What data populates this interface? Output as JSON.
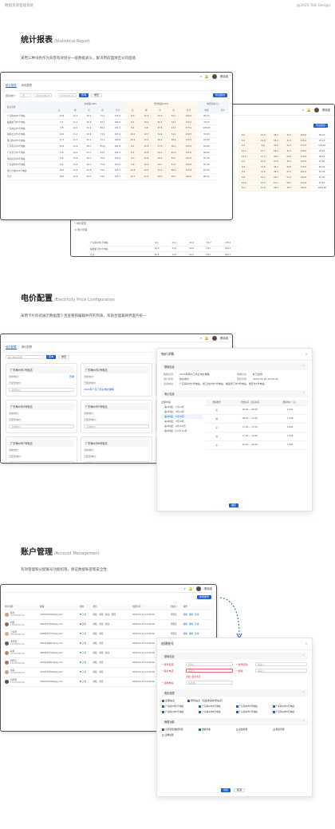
{
  "header": {
    "left": "数据资源管理系统",
    "right": "@2025 ToB Design"
  },
  "sections": [
    {
      "title": "统计报表",
      "en": "/Statistical Report",
      "desc": "采用三种浅色作为背景有效划分一级数据表头，解决用前面清区分的困境"
    },
    {
      "title": "电价配置",
      "en": "/Electricity Price Configuration",
      "desc": "采用卡片形式展示数据量少且查看和编辑并存的列表，有助合理兼顾界面齐统一"
    },
    {
      "title": "账户管理",
      "en": "/Account Management",
      "desc": "有效管理和分配账号功能权限，保证数据私密和安全性"
    }
  ],
  "user": {
    "name": "曹晓强"
  },
  "report": {
    "tabs": [
      "统计报表",
      "用电报表"
    ],
    "filter_label": "报表统计：",
    "filter_value": "日",
    "date_start": "2024-08-15",
    "date_end": "2024-08-15",
    "query": "查询",
    "reset": "重置",
    "export": "导出报表",
    "groups": [
      "用电量(kWh)",
      "费用电量(kWh)",
      "电费金额(元)"
    ],
    "cols": [
      "尖",
      "峰",
      "平",
      "谷",
      "合计",
      "尖",
      "峰",
      "平",
      "谷",
      "合计",
      "电费",
      "合计"
    ],
    "first_col": "站点名称",
    "rows": [
      [
        "广东梅州市1号电站",
        "10.8",
        "12.2",
        "39.4",
        "79.2",
        "235.8",
        "8.0",
        "15.9",
        "46.3",
        "32.1",
        "100.0",
        "86.23"
      ],
      [
        "福建厦门市2号电站",
        "9.2",
        "11.2",
        "45.9",
        "84.1",
        "286.8",
        "8.2",
        "15.9",
        "52.2",
        "32.1",
        "135.0",
        "70.23"
      ],
      [
        "广东佛山市3号电站",
        "9.8",
        "16.2",
        "51.2",
        "80.0",
        "231.4",
        "8.2",
        "9.8",
        "47.6",
        "41.2",
        "173.2",
        "103.63"
      ],
      [
        "湖南长沙市4号电站",
        "10.6",
        "11.1",
        "52.8",
        "73.2",
        "265.0",
        "10.2",
        "13.7",
        "54.4",
        "31.2",
        "130.5",
        "97.03"
      ],
      [
        "浙江杭州市5号电站",
        "11.2",
        "13.3",
        "52.1",
        "75.2",
        "289.8",
        "10.9",
        "12.6",
        "46.2",
        "56.4",
        "116.9",
        "82.69"
      ],
      [
        "江苏南京市6号电站",
        "10.9",
        "12.6",
        "48.1",
        "85.0",
        "287.6",
        "9.2",
        "15.9",
        "47.8",
        "36.1",
        "125.0",
        "81.69"
      ],
      [
        "广东湛江市7号电站",
        "8.8",
        "14.2",
        "47.3",
        "83.2",
        "221.4",
        "8.2",
        "12.8",
        "46.1",
        "40.6",
        "115.0",
        "82.92"
      ],
      [
        "湖北武汉市8号电站",
        "8.8",
        "12.9",
        "45.1",
        "76.5",
        "276.4",
        "8.0",
        "11.8",
        "46.2",
        "53.7",
        "162.0",
        "87.49"
      ],
      [
        "广东深圳市9号电站",
        "9.4",
        "14.3",
        "49.1",
        "75.6",
        "253.8",
        "9.8",
        "12.2",
        "49.7",
        "51.3",
        "100.6",
        "87.49"
      ],
      [
        "浙江宁波市10号电站",
        "10.6",
        "12.8",
        "50.8",
        "79.1",
        "243.7",
        "10.6",
        "12.5",
        "51.2",
        "58.2",
        "115.8",
        "87.63"
      ],
      [
        "合计",
        "10.6",
        "13.9",
        "50.5",
        "79.1",
        "243.7",
        "10.7",
        "11.8",
        "48.3",
        "38.7",
        "160.0",
        "86.22"
      ]
    ]
  },
  "report_back": {
    "sidebar": [
      "电价配置",
      "账户管理"
    ],
    "export": "导出报表",
    "rows": [
      [
        "广东梅州市1号电站",
        "9.4",
        "15.7",
        "12.9",
        "54.7",
        "178.1"
      ],
      [
        "福建厦门市2号电站",
        "10.6",
        "13.5",
        "50.8",
        "79.1",
        "243.7"
      ],
      [
        "合计",
        "10.6",
        "13.9",
        "50.5",
        "79.1",
        "243.7"
      ]
    ],
    "right_cols": [
      [
        "8.0",
        "15.9",
        "46.3",
        "32.1",
        "100.0",
        "86.23"
      ],
      [
        "8.2",
        "15.9",
        "52.2",
        "32.1",
        "135.0",
        "70.23"
      ],
      [
        "8.2",
        "9.8",
        "47.6",
        "41.2",
        "173.2",
        "103.63"
      ],
      [
        "10.2",
        "13.7",
        "54.4",
        "31.2",
        "130.5",
        "97.03"
      ],
      [
        "10.9",
        "12.6",
        "46.2",
        "56.4",
        "116.9",
        "82.69"
      ],
      [
        "9.2",
        "15.9",
        "47.8",
        "36.1",
        "125.0",
        "81.69"
      ],
      [
        "8.2",
        "12.8",
        "46.1",
        "40.6",
        "115.0",
        "82.92"
      ],
      [
        "8.0",
        "11.8",
        "46.2",
        "53.7",
        "162.0",
        "87.49"
      ],
      [
        "9.8",
        "12.2",
        "49.7",
        "51.3",
        "100.6",
        "87.49"
      ],
      [
        "10.6",
        "12.5",
        "51.2",
        "58.2",
        "115.8",
        "87.63"
      ],
      [
        "10.7",
        "11.8",
        "48.3",
        "38.7",
        "160.0",
        "1024.00"
      ]
    ]
  },
  "price": {
    "tabs": [
      "电价配置",
      "调价配置"
    ],
    "search_placeholder": "输入电站名称",
    "query": "查询",
    "reset": "重置",
    "cards": [
      {
        "title": "广东梅州市1号电站",
        "a_label": "当前电价：",
        "a_val": "查看",
        "b_label": "已配置电价：",
        "b_val": "选择电价"
      },
      {
        "title": "广东梅州市2号电站",
        "a_label": "当前电价：",
        "a_val": "",
        "b_label": "已配置电价：",
        "b_val": "2024年广东工商业电价策略"
      },
      {
        "title": "广东梅州市3号电站",
        "a_label": "当前电价：",
        "a_val": "",
        "b_label": "已配置电价：",
        "b_val": "2024年广东工商业电价策略"
      },
      {
        "title": "广东梅州市4号电站",
        "a_label": "当前电价：",
        "a_val": "",
        "b_label": "已配置电价：",
        "b_val": "选择电价"
      },
      {
        "title": "广东梅州市5号电站",
        "a_label": "当前电价：",
        "a_val": "",
        "b_label": "已配置电价：",
        "b_val": "选择电价"
      },
      {
        "title": "广东梅州市6号电站",
        "a_label": "当前电价：",
        "a_val": "",
        "b_label": "已配置电价：",
        "b_val": "选择电价"
      },
      {
        "title": "广东梅州市7号电站",
        "a_label": "当前电价：",
        "a_val": "",
        "b_label": "已配置电价：",
        "b_val": "选择电价"
      },
      {
        "title": "广东梅州市8号电站",
        "a_label": "当前电价：",
        "a_val": "",
        "b_label": "已配置电价：",
        "b_val": "选择电价"
      },
      {
        "title": "广东梅州市9号电站",
        "a_label": "当前电价：",
        "a_val": "",
        "b_label": "已配置电价：",
        "b_val": "2024年广东工商业电价策略"
      }
    ],
    "bottom_links": [
      "2024年广东工商业电价策略",
      "选择电价",
      "2024年广东工商业电价策略"
    ]
  },
  "price_modal": {
    "title": "电价详情",
    "basic": "基础信息",
    "k1": "策略名称",
    "v1": "2024年梅州工商业电价策略",
    "k2": "策略状态",
    "v2": "已启用",
    "k3": "电价类型",
    "v3": "峰谷电价",
    "k4": "更新时间",
    "v4": "2024-05-26 12:00:00",
    "k5": "适用电站",
    "v5": "广东梅州市1号电站，浙江杭州市3号电站，福建厦门市3号电站，重庆市1号电站",
    "section2": "电价信息",
    "tree_root": "全部时段",
    "tree": [
      "第1时段：1月-2月",
      "第2时段：3月-4月",
      "第3时段：5月-6月",
      "第4时段：7月-8月",
      "第5时段：9月-10月",
      "第6时段：11月-12月"
    ],
    "cols": [
      "费率类型",
      "开始时间 - 结束时间",
      "费率单价（元）"
    ],
    "rates": [
      [
        "尖",
        "00:00",
        "08:00",
        "0.291"
      ],
      [
        "峰",
        "08:00",
        "11:00",
        "1.268"
      ],
      [
        "平",
        "11:00",
        "17:00",
        "0.642"
      ],
      [
        "谷",
        "17:00",
        "22:00",
        "2.326"
      ],
      [
        "平",
        "22:00",
        "00:00",
        "1.683"
      ]
    ],
    "ok": "确定"
  },
  "account": {
    "add": "新增账号",
    "cols": [
      "用户名称",
      "邮箱",
      "状态",
      "角色",
      "创建时间",
      "创建人",
      "操作"
    ],
    "rows": [
      {
        "name": "陈伟",
        "phone": "15900000001",
        "email": "7465053590@qq.com",
        "status": "正常",
        "role": "审核、浏览、修改、管理",
        "time": "2024-04-14 12:00:00",
        "creator": "李国庆",
        "av": "#c9a27e"
      },
      {
        "name": "刘强",
        "phone": "15900000002",
        "email": "4562357360@qq.com",
        "status": "禁用",
        "role": "审核、浏览、修改",
        "time": "2024-04-14 12:00:00",
        "creator": "李国庆",
        "av": "#8a6b5a"
      },
      {
        "name": "王家明",
        "phone": "15900000003",
        "email": "4786542372@qq.com",
        "status": "正常",
        "role": "审核、浏览",
        "time": "2024-04-14 12:00:00",
        "creator": "李国庆",
        "av": "#d6b08c"
      },
      {
        "name": "李晓丽",
        "phone": "15900000004",
        "email": "7662338897@qq.com",
        "status": "正常",
        "role": "审核、浏览",
        "time": "2024-04-14 12:00:00",
        "creator": "李国庆",
        "av": "#6e5548"
      },
      {
        "name": "赵莉",
        "phone": "15900000005",
        "email": "4889521720@qq.com",
        "status": "正常",
        "role": "审核、浏览、修改",
        "time": "2024-04-14 12:00:00",
        "creator": "李国庆",
        "av": "#b48a6a"
      },
      {
        "name": "周晓东",
        "phone": "15900000006",
        "email": "4756234851@qq.com",
        "status": "正常",
        "role": "审核、浏览",
        "time": "2024-04-14 12:00:00",
        "creator": "李国庆",
        "av": "#9b7b66"
      },
      {
        "name": "孙丽",
        "phone": "15900000007",
        "email": "4756235890@qq.com",
        "status": "正常",
        "role": "审核、浏览",
        "time": "2024-04-14 12:00:00",
        "creator": "李国庆",
        "av": "#c7a389"
      },
      {
        "name": "吴晓明",
        "phone": "15900000008",
        "email": "7465053590@qq.com",
        "status": "正常",
        "role": "审核、浏览",
        "time": "2024-04-14 12:00:00",
        "creator": "李国庆",
        "av": "#5e4a40"
      }
    ],
    "ops": [
      "编辑",
      "删除",
      "禁用"
    ]
  },
  "account_modal": {
    "title": "创建账号",
    "basic": "基础信息",
    "f1": "* 账号名称",
    "p1": "请输入",
    "f2": "* 账号密码",
    "p2": "请输入",
    "f3": "* 联系电话",
    "p3": "请输入",
    "f4": "* 邮箱",
    "p4": "请输入",
    "hint": "请输入联系电话",
    "f5": "* 适用电站",
    "p5": "请选择",
    "auth": "角色权限",
    "all": "全部站点",
    "opt": "所有站点（包括未来新增站点）",
    "stations": [
      "广东梅州市1号电站",
      "广东梅州市2号电站",
      "广东梅州市3号电站",
      "广东梅州市4号电站",
      "广东梅州市5号电站",
      "广东梅州市6号电站",
      "广东梅州市7号电站",
      "广东梅州市8号电站"
    ],
    "func": "管理功能",
    "funcs": [
      "全部权限/数据管理",
      "数据查看",
      "系统管理",
      "报表管理",
      "运维处理"
    ],
    "create": "创建",
    "cancel": "取消"
  }
}
